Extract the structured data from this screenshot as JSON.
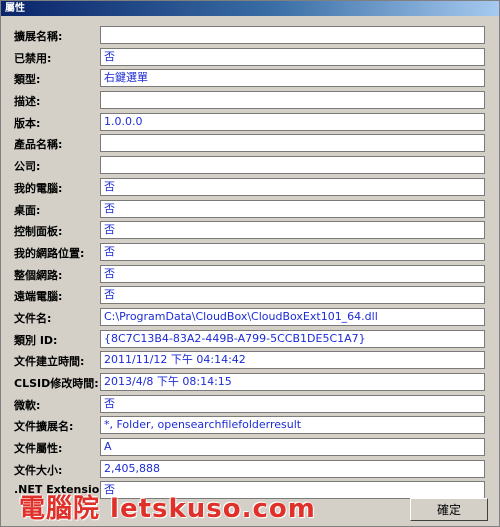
{
  "window": {
    "title": "屬性"
  },
  "properties": [
    {
      "label": "擴展名稱:",
      "value": ""
    },
    {
      "label": "已禁用:",
      "value": "否"
    },
    {
      "label": "類型:",
      "value": "右鍵選單"
    },
    {
      "label": "描述:",
      "value": ""
    },
    {
      "label": "版本:",
      "value": "1.0.0.0"
    },
    {
      "label": "產品名稱:",
      "value": ""
    },
    {
      "label": "公司:",
      "value": ""
    },
    {
      "label": "我的電腦:",
      "value": "否"
    },
    {
      "label": "桌面:",
      "value": "否"
    },
    {
      "label": "控制面板:",
      "value": "否"
    },
    {
      "label": "我的網路位置:",
      "value": "否"
    },
    {
      "label": "整個網路:",
      "value": "否"
    },
    {
      "label": "遠端電腦:",
      "value": "否"
    },
    {
      "label": "文件名:",
      "value": "C:\\ProgramData\\CloudBox\\CloudBoxExt101_64.dll"
    },
    {
      "label": "類別 ID:",
      "value": "{8C7C13B4-83A2-449B-A799-5CCB1DE5C1A7}"
    },
    {
      "label": "文件建立時間:",
      "value": "2011/11/12 下午 04:14:42"
    },
    {
      "label": "CLSID修改時間:",
      "value": "2013/4/8 下午 08:14:15"
    },
    {
      "label": "微軟:",
      "value": "否"
    },
    {
      "label": "文件擴展名:",
      "value": "*, Folder, opensearchfilefolderresult"
    },
    {
      "label": "文件屬性:",
      "value": "A"
    },
    {
      "label": "文件大小:",
      "value": "2,405,888"
    },
    {
      "label": ".NET Extension:",
      "value": "否"
    }
  ],
  "buttons": {
    "ok_label": "確定"
  },
  "watermark": {
    "text": "電腦院 letskuso.com",
    "color": "#e0302a"
  }
}
